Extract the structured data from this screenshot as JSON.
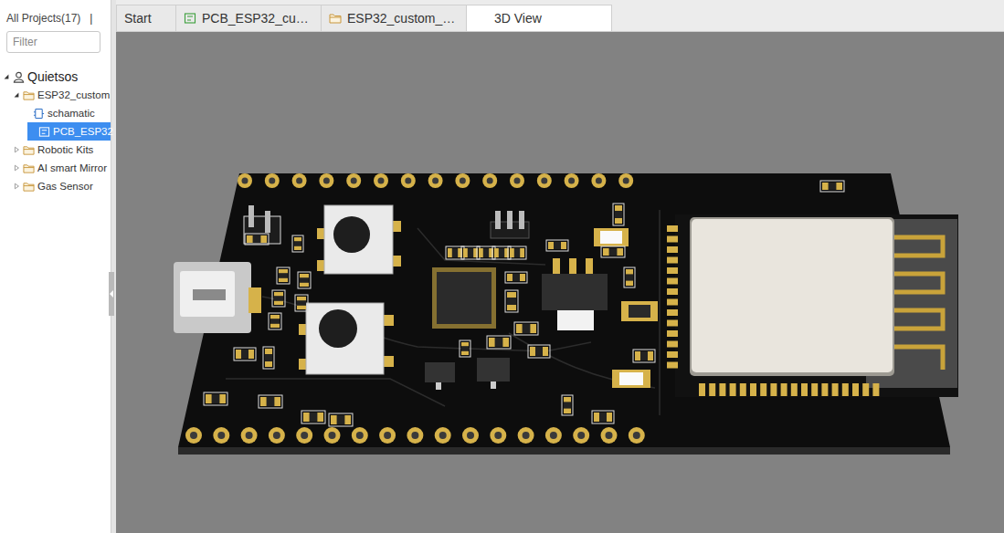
{
  "sidebar": {
    "header": "All Projects(17)",
    "separator": "|",
    "filter": {
      "placeholder": "Filter",
      "value": ""
    },
    "tree": [
      {
        "label": "Quietsos",
        "kind": "user",
        "depth": 0,
        "expandable": true,
        "expanded": true,
        "selected": false
      },
      {
        "label": "ESP32_custom",
        "kind": "folder",
        "depth": 1,
        "expandable": true,
        "expanded": true,
        "selected": false
      },
      {
        "label": "schamatic",
        "kind": "schematic",
        "depth": 2,
        "expandable": false,
        "expanded": false,
        "selected": false
      },
      {
        "label": "PCB_ESP32",
        "kind": "pcb",
        "depth": 2,
        "expandable": false,
        "expanded": false,
        "selected": true
      },
      {
        "label": "Robotic Kits",
        "kind": "folder",
        "depth": 1,
        "expandable": true,
        "expanded": false,
        "selected": false
      },
      {
        "label": "AI smart Mirror",
        "kind": "folder",
        "depth": 1,
        "expandable": true,
        "expanded": false,
        "selected": false
      },
      {
        "label": "Gas Sensor",
        "kind": "folder",
        "depth": 1,
        "expandable": true,
        "expanded": false,
        "selected": false
      }
    ]
  },
  "tabs": [
    {
      "label": "Start",
      "kind": "plain",
      "selected": false
    },
    {
      "label": "PCB_ESP32_cu…",
      "kind": "pcb",
      "selected": false
    },
    {
      "label": "ESP32_custom_…",
      "kind": "folder",
      "selected": false
    },
    {
      "label": "3D View",
      "kind": "plain",
      "selected": true
    }
  ]
}
